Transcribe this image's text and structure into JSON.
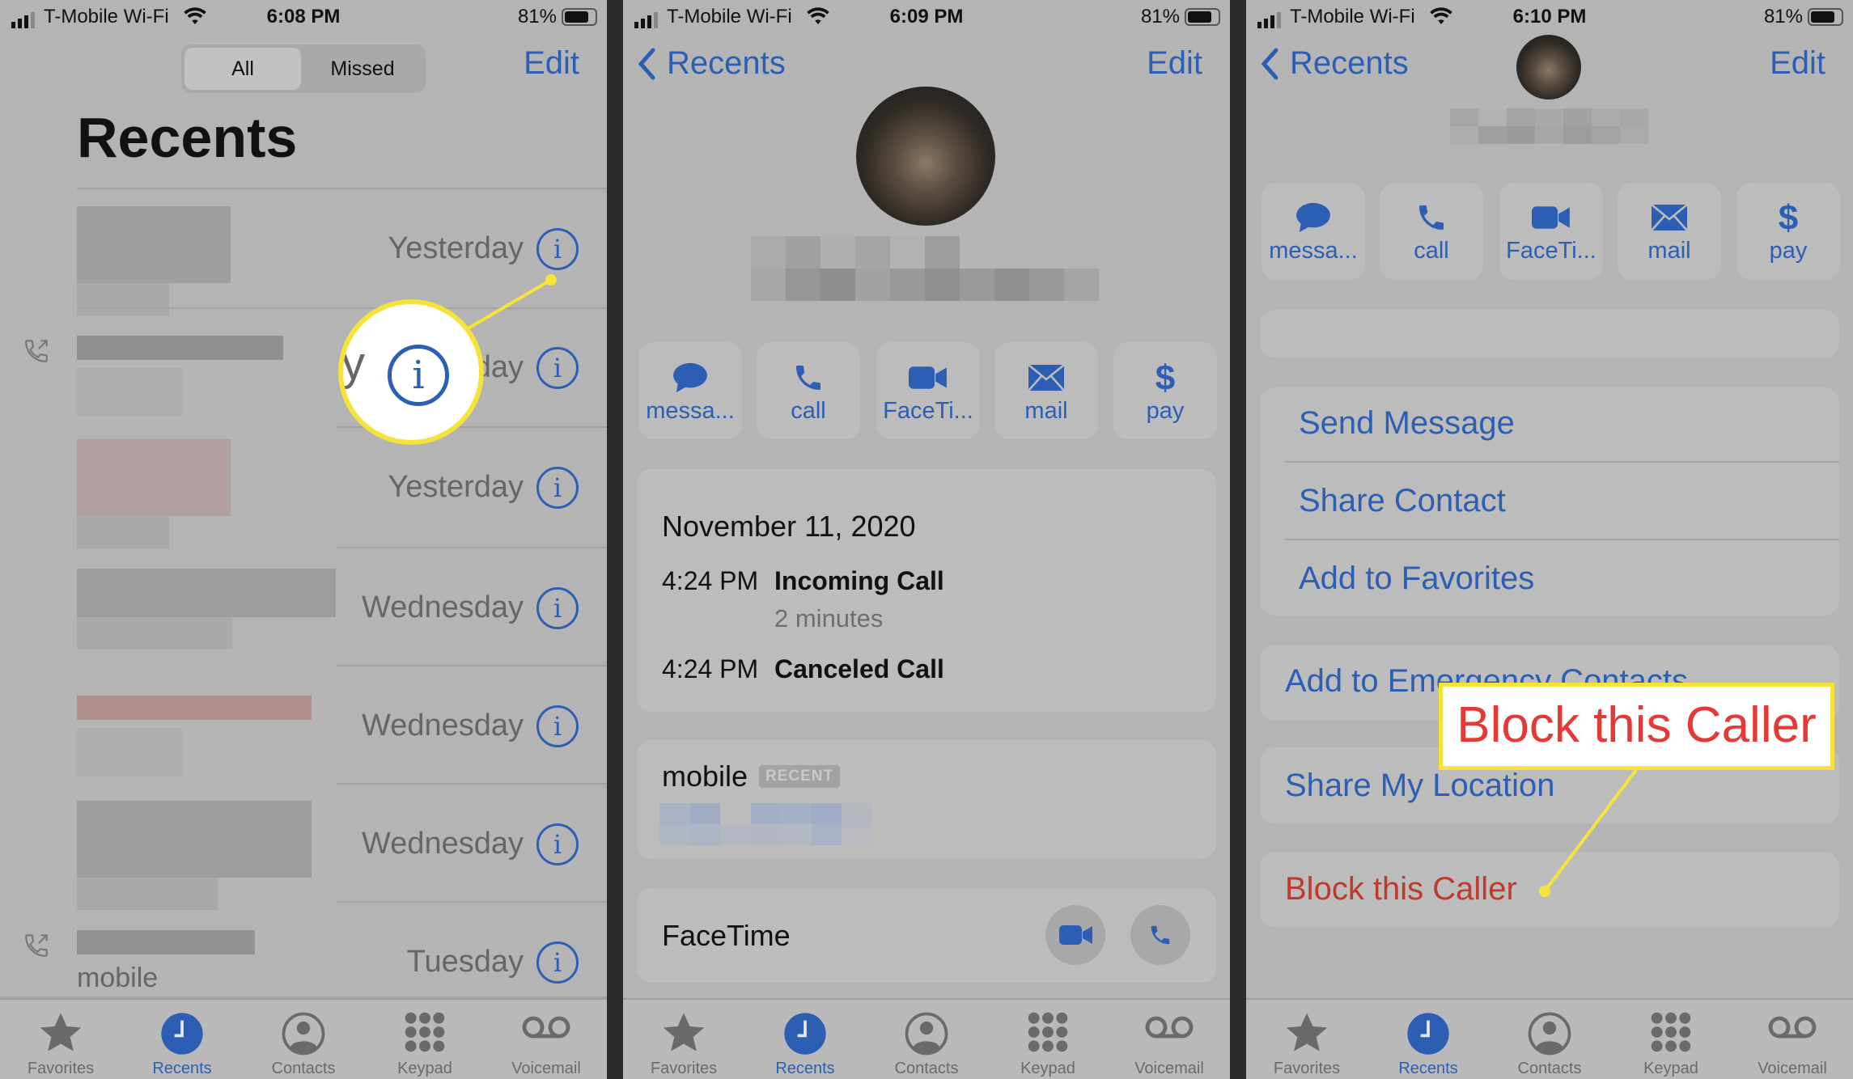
{
  "colors": {
    "accent": "#2c5fb4",
    "destructive": "#c0392b",
    "callout_border": "#f5e33a",
    "callout_text": "#e53935"
  },
  "panels": [
    {
      "status": {
        "carrier": "T-Mobile Wi-Fi",
        "time": "6:08 PM",
        "battery": "81%"
      }
    },
    {
      "status": {
        "carrier": "T-Mobile Wi-Fi",
        "time": "6:09 PM",
        "battery": "81%"
      }
    },
    {
      "status": {
        "carrier": "T-Mobile Wi-Fi",
        "time": "6:10 PM",
        "battery": "81%"
      }
    }
  ],
  "battery_level": 0.81,
  "tabbar": {
    "active": "Recents",
    "items": [
      {
        "label": "Favorites",
        "icon": "star-icon"
      },
      {
        "label": "Recents",
        "icon": "clock-icon"
      },
      {
        "label": "Contacts",
        "icon": "person-circle-icon"
      },
      {
        "label": "Keypad",
        "icon": "keypad-icon"
      },
      {
        "label": "Voicemail",
        "icon": "voicemail-icon"
      }
    ]
  },
  "recents": {
    "segments": {
      "all": "All",
      "missed": "Missed"
    },
    "edit": "Edit",
    "title": "Recents",
    "rows": [
      {
        "date": "Yesterday"
      },
      {
        "date": "Yesterday",
        "outgoing": true
      },
      {
        "date": "Yesterday"
      },
      {
        "date": "Wednesday"
      },
      {
        "date": "Wednesday"
      },
      {
        "date": "Wednesday"
      },
      {
        "date": "Tuesday",
        "outgoing": true,
        "subtitle": "mobile"
      }
    ],
    "magnifier_text": "y"
  },
  "detail": {
    "back": "Recents",
    "edit": "Edit",
    "actions": [
      {
        "label": "messa...",
        "icon": "message-bubble-icon"
      },
      {
        "label": "call",
        "icon": "phone-icon"
      },
      {
        "label": "FaceTi...",
        "icon": "video-camera-icon"
      },
      {
        "label": "mail",
        "icon": "envelope-icon"
      },
      {
        "label": "pay",
        "icon": "dollar-icon"
      }
    ],
    "call_date": "November 11, 2020",
    "calls": [
      {
        "time": "4:24 PM",
        "type": "Incoming Call",
        "duration": "2 minutes"
      },
      {
        "time": "4:24 PM",
        "type": "Canceled Call"
      }
    ],
    "phone_label": "mobile",
    "phone_badge": "RECENT",
    "facetime": "FaceTime"
  },
  "contact": {
    "back": "Recents",
    "edit": "Edit",
    "menu": [
      "Send Message",
      "Share Contact",
      "Add to Favorites"
    ],
    "emergency": "Add to Emergency Contacts",
    "share_location": "Share My Location",
    "block": "Block this Caller",
    "callout": "Block this Caller"
  }
}
